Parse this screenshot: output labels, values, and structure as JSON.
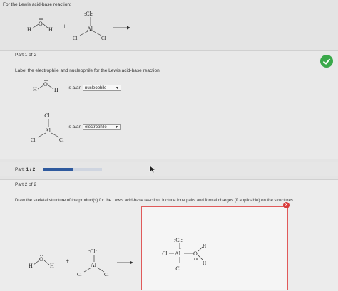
{
  "header": {
    "title": "For the Lewis acid-base reaction:"
  },
  "reaction": {
    "plus": "+"
  },
  "part1": {
    "label": "Part 1 of 2",
    "instruction": "Label the electrophile and nucleophile for the Lewis acid-base reaction.",
    "row1": {
      "prefix": "is a/an",
      "selected": "nucleophile"
    },
    "row2": {
      "prefix": "is a/an",
      "selected": "electrophile"
    },
    "status": "correct"
  },
  "progress": {
    "label": "Part:",
    "value": "1 / 2",
    "fraction": 0.5
  },
  "part2": {
    "label": "Part 2 of 2",
    "instruction": "Draw the skeletal structure of the product(s) for the Lewis acid-base reaction. Include lone pairs and formal charges (if applicable) on the structures."
  },
  "chem": {
    "H": "H",
    "O": "O",
    "Al": "Al",
    "Cl": "Cl",
    "ClTop": ":Cl:",
    "ClBot": ":Cl:",
    "ClLeft": ":Cl",
    "plus": "+",
    "minus": "−"
  },
  "colors": {
    "accent": "#2f5a9e",
    "success": "#3aa84a",
    "error": "#d93b3b"
  }
}
